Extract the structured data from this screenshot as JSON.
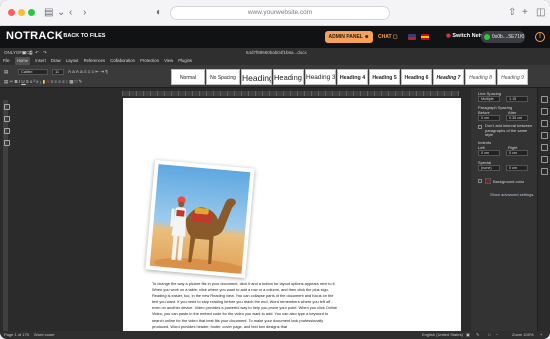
{
  "browser": {
    "url": "www.yourwebsite.com",
    "icons": [
      "sidebar-icon",
      "back-icon",
      "forward-icon",
      "shield-icon",
      "share-icon",
      "new-tab-icon",
      "tabs-icon"
    ]
  },
  "app_header": {
    "logo_text": "NOTRACK",
    "back_label": "BACK TO FILES",
    "admin_panel_label": "ADMIN PANEL",
    "chat_label": "CHAT",
    "switch_network_label": "Switch Network",
    "wallet_label": "0x0b....5E71f0",
    "colors": {
      "accent": "#f5a25a",
      "header_bg": "#111214",
      "wallet_green": "#28c840"
    }
  },
  "editor": {
    "app_name": "ONLYOFFICE",
    "doc_title": "64d7f89660bab04f1b6a...docx",
    "menu": [
      "File",
      "Home",
      "Insert",
      "Draw",
      "Layout",
      "References",
      "Collaboration",
      "Protection",
      "View",
      "Plugins"
    ],
    "active_menu": "Home",
    "font_name": "Calibri",
    "font_size": "11",
    "styles": [
      "Normal",
      "No Spacing",
      "Heading 1",
      "Heading 2",
      "Heading 3",
      "Heading 4",
      "Heading 5",
      "Heading 6",
      "Heading 7",
      "Heading 8",
      "Heading 9"
    ]
  },
  "document": {
    "body_text": "To change the way a picture fits in your document, click it and a button for layout options appears next to it. When you work on a table, click where you want to add a row or a column, and then click the plus sign. Reading is easier, too, in the new Reading view. You can collapse parts of the document and focus on the text you want. If you need to stop reading before you reach the end, Word remembers where you left off - even on another device. Video provides a powerful way to help you prove your point. When you click Online Video, you can paste in the embed code for the video you want to add. You can also type a keyword to search online for the video that best fits your document. To make your document look professionally produced, Word provides header, footer, cover page, and text box designs that"
  },
  "right_panel": {
    "line_spacing_label": "Line Spacing",
    "line_spacing_value": "Multiple",
    "line_spacing_amount": "1.15",
    "paragraph_spacing_label": "Paragraph Spacing",
    "before_label": "Before",
    "after_label": "After",
    "before_value": "0 cm",
    "after_value": "0.35 cm",
    "dont_add_interval": "Don't add interval between paragraphs of the same style",
    "indents_label": "Indents",
    "left_label": "Left",
    "right_label": "Right",
    "left_value": "0 cm",
    "right_value": "0 cm",
    "special_label": "Special",
    "special_value": "(none)",
    "special_amount": "0 cm",
    "background_color_label": "Background color",
    "advanced_settings_label": "Show advanced settings"
  },
  "statusbar": {
    "page_info": "Page 1 of 175",
    "word_count": "Word count",
    "language": "English (United States)",
    "zoom": "Zoom 100%"
  }
}
